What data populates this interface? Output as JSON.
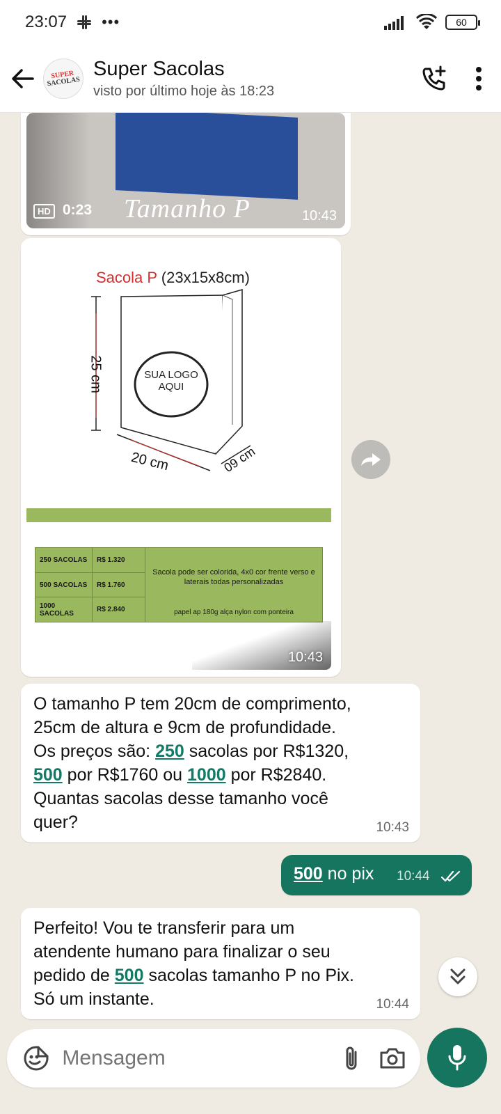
{
  "status_bar": {
    "time": "23:07",
    "battery": "60"
  },
  "header": {
    "contact_name": "Super Sacolas",
    "contact_status": "visto por último hoje às 18:23",
    "avatar_text_1": "SUPER",
    "avatar_text_2": "SACOLAS"
  },
  "messages": {
    "video": {
      "hd_badge": "HD",
      "duration": "0:23",
      "caption": "Tamanho P",
      "time": "10:43"
    },
    "image": {
      "title_red": "Sacola P",
      "title_rest": "(23x15x8cm)",
      "height_label": "25 cm",
      "width_label": "20 cm",
      "depth_label": "09 cm",
      "logo_text_1": "SUA LOGO",
      "logo_text_2": "AQUI",
      "table": {
        "quantities": [
          "250 SACOLAS",
          "500 SACOLAS",
          "1000 SACOLAS"
        ],
        "prices": [
          "R$ 1.320",
          "R$ 1.760",
          "R$ 2.840"
        ],
        "description": "Sacola pode ser colorida, 4x0 cor frente verso e laterais  todas personalizadas",
        "paper": "papel ap 180g alça nylon com ponteira"
      },
      "time": "10:43"
    },
    "info": {
      "line1": "O tamanho P tem 20cm de comprimento,",
      "line2": "25cm de altura e 9cm de profundidade.",
      "line3_pre": "Os preços são: ",
      "link_250": "250",
      "line3_post": " sacolas por R$1320,",
      "link_500": "500",
      "line4_mid": " por R$1760 ou ",
      "link_1000": "1000",
      "line4_post": " por R$2840.",
      "line5": "Quantas sacolas desse tamanho você",
      "line6": "quer?",
      "time": "10:43"
    },
    "reply": {
      "link_500": "500",
      "text": " no pix",
      "time": "10:44"
    },
    "confirm": {
      "line1": "Perfeito! Vou te transferir para um",
      "line2": "atendente humano para finalizar o seu",
      "line3_pre": "pedido de ",
      "link_500": "500",
      "line3_post": " sacolas tamanho P no Pix.",
      "line4": "Só um instante.",
      "time": "10:44"
    }
  },
  "composer": {
    "placeholder": "Mensagem"
  },
  "colors": {
    "accent": "#16755f",
    "link": "#127a65",
    "background": "#efeae2"
  }
}
